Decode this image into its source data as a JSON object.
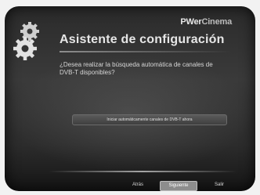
{
  "header": {
    "brand_part1": "PWer",
    "brand_part2": "Cinema",
    "title": "Asistente de configuración"
  },
  "content": {
    "question": "¿Desea realizar la búsqueda automática de canales de DVB-T disponibles?",
    "scan_button_label": "Iniciar automáticamente canales de DVB-T ahora"
  },
  "footer": {
    "back_label": "Atrás",
    "next_label": "Siguiente",
    "exit_label": "Salir"
  },
  "colors": {
    "background": "#2b2b2b",
    "text": "#e6e6e6",
    "selected_button": "#8d8d8d"
  },
  "icons": [
    "gears-icon"
  ]
}
